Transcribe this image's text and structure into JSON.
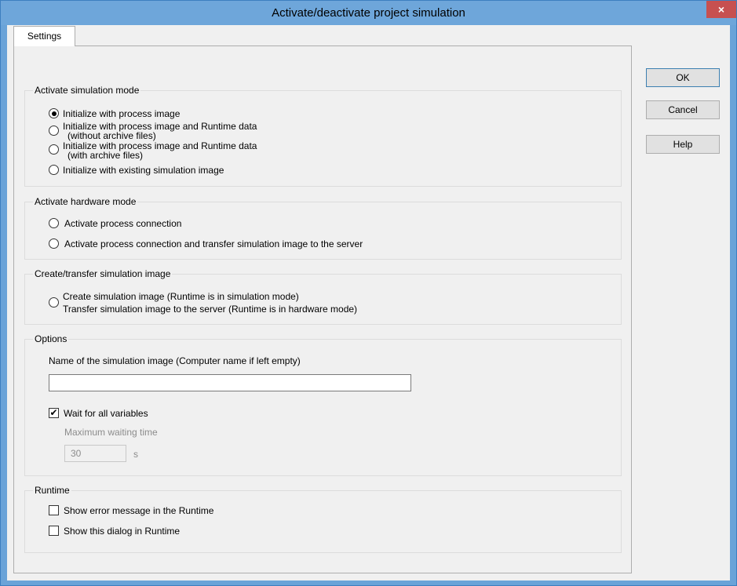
{
  "window": {
    "title": "Activate/deactivate project simulation",
    "close_glyph": "×"
  },
  "tabs": [
    {
      "label": "Settings"
    }
  ],
  "buttons": {
    "ok": "OK",
    "cancel": "Cancel",
    "help": "Help"
  },
  "sim_mode": {
    "title": "Activate simulation mode",
    "options": [
      {
        "line1": "Initialize with process image",
        "line2": "",
        "checked": true
      },
      {
        "line1": "Initialize with process image and Runtime data",
        "line2": "(without archive files)",
        "checked": false
      },
      {
        "line1": "Initialize with process image and Runtime data",
        "line2": "(with archive files)",
        "checked": false
      },
      {
        "line1": "Initialize with existing simulation image",
        "line2": "",
        "checked": false
      }
    ]
  },
  "hw_mode": {
    "title": "Activate hardware mode",
    "options": [
      {
        "label": "Activate process connection",
        "checked": false
      },
      {
        "label": "Activate process connection and transfer simulation image to the server",
        "checked": false
      }
    ]
  },
  "create_transfer": {
    "title": "Create/transfer simulation image",
    "line1": "Create simulation image (Runtime is in simulation mode)",
    "line2": "Transfer simulation image to the server (Runtime is in hardware mode)"
  },
  "options": {
    "title": "Options",
    "name_label": "Name of the simulation image (Computer name if left empty)",
    "name_value": "",
    "wait_all": {
      "label": "Wait for all variables",
      "checked": true,
      "mark": "✔"
    },
    "max_wait_label": "Maximum waiting time",
    "max_wait_value": "30",
    "max_wait_unit": "s"
  },
  "runtime": {
    "title": "Runtime",
    "show_error": {
      "label": "Show error message in the Runtime",
      "checked": false
    },
    "show_dialog": {
      "label": "Show this dialog in Runtime",
      "checked": false
    }
  },
  "colors": {
    "title_bar": "#6ea6da",
    "close_button": "#c75050",
    "dialog_bg": "#f0f0f0"
  }
}
